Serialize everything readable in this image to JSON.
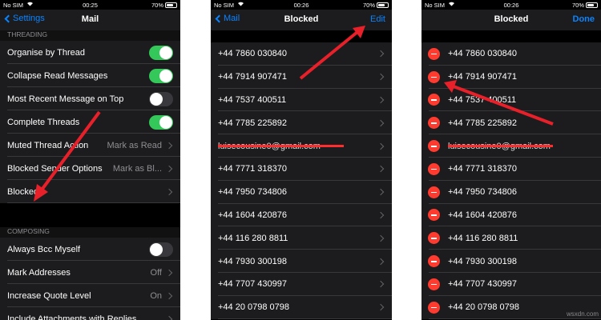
{
  "status": {
    "carrier": "No SIM",
    "battery": "70%"
  },
  "screen1": {
    "time": "00:25",
    "back_label": "Settings",
    "title": "Mail",
    "section_threading": "THREADING",
    "rows": [
      {
        "label": "Organise by Thread",
        "kind": "toggle",
        "on": true
      },
      {
        "label": "Collapse Read Messages",
        "kind": "toggle",
        "on": true
      },
      {
        "label": "Most Recent Message on Top",
        "kind": "toggle",
        "on": false
      },
      {
        "label": "Complete Threads",
        "kind": "toggle",
        "on": true
      },
      {
        "label": "Muted Thread Action",
        "kind": "nav",
        "value": "Mark as Read"
      },
      {
        "label": "Blocked Sender Options",
        "kind": "nav",
        "value": "Mark as Bl..."
      },
      {
        "label": "Blocked",
        "kind": "nav",
        "value": ""
      }
    ],
    "section_composing": "COMPOSING",
    "rows2": [
      {
        "label": "Always Bcc Myself",
        "kind": "toggle",
        "on": false
      },
      {
        "label": "Mark Addresses",
        "kind": "nav",
        "value": "Off"
      },
      {
        "label": "Increase Quote Level",
        "kind": "nav",
        "value": "On"
      },
      {
        "label": "Include Attachments with Replies",
        "kind": "nav",
        "value": ""
      }
    ]
  },
  "screen2": {
    "time": "00:26",
    "back_label": "Mail",
    "title": "Blocked",
    "right_label": "Edit"
  },
  "screen3": {
    "time": "00:26",
    "title": "Blocked",
    "right_label": "Done"
  },
  "blocked_list": [
    "+44 7860 030840",
    "+44 7914 907471",
    "+44 7537 400511",
    "+44 7785 225892",
    "luisecousine0@gmail.com",
    "+44 7771 318370",
    "+44 7950 734806",
    "+44 1604 420876",
    "+44 116 280 8811",
    "+44 7930 300198",
    "+44 7707 430997",
    "+44 20 0798 0798"
  ],
  "colors": {
    "accent": "#0a84ff",
    "toggle_on": "#34c759",
    "delete": "#ff3b30",
    "arrow": "#e8202a"
  },
  "watermark": "wsxdn.com"
}
